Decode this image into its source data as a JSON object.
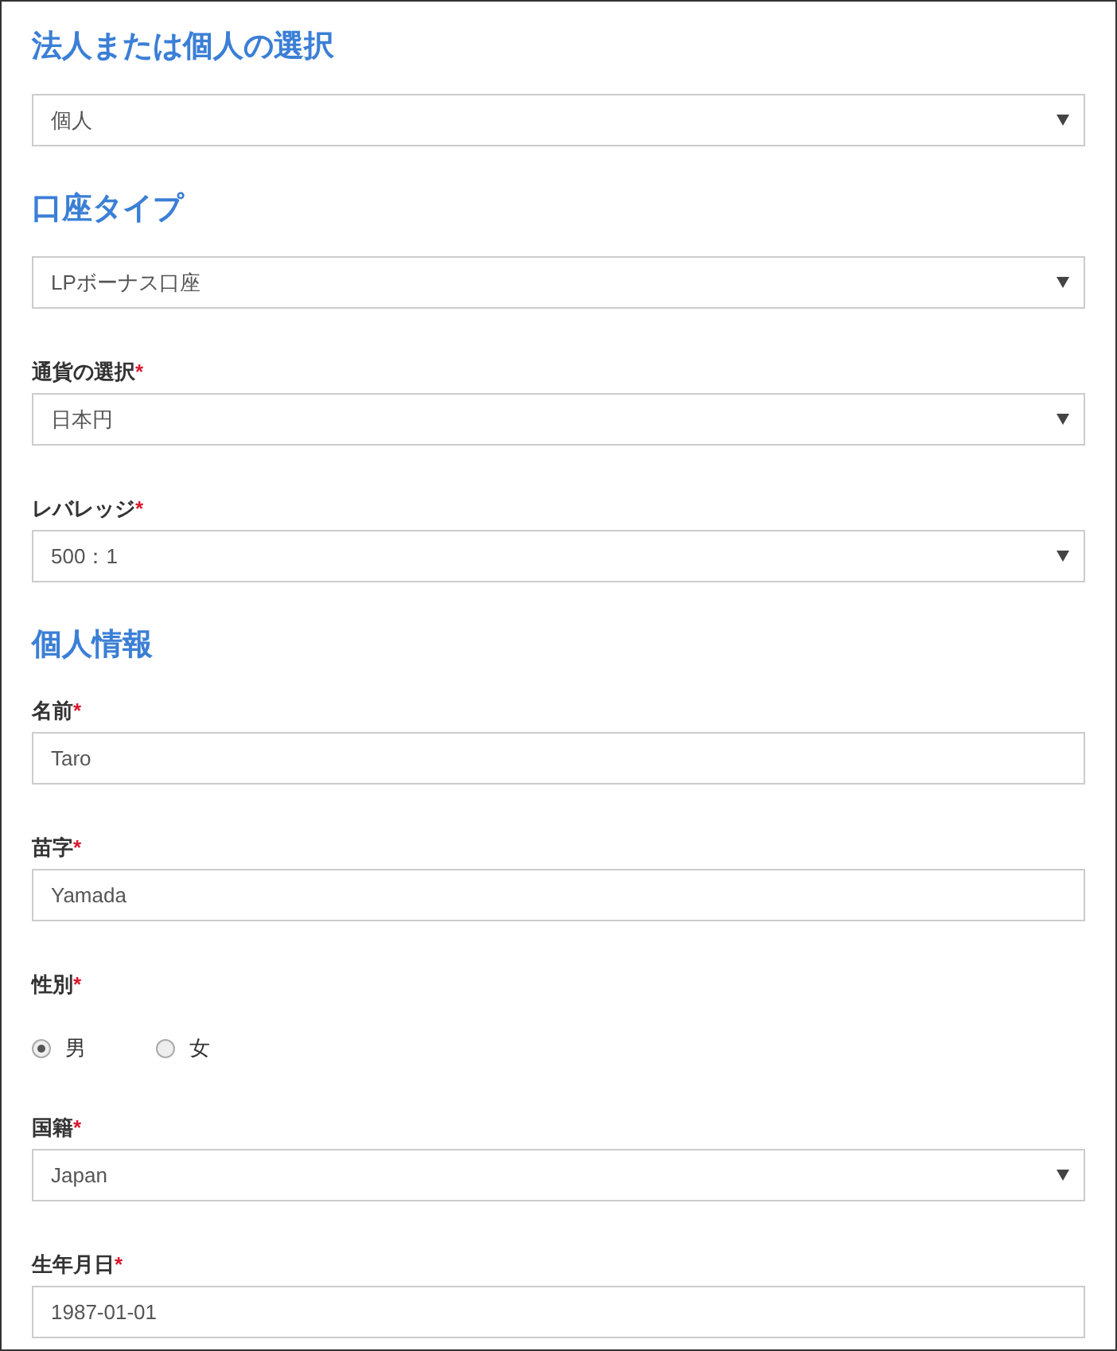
{
  "form": [
    {
      "kind": "heading",
      "text": "法人または個人の選択"
    },
    {
      "kind": "select",
      "value": "個人"
    },
    {
      "kind": "heading",
      "text": "口座タイプ"
    },
    {
      "kind": "select",
      "value": "LPボーナス口座"
    },
    {
      "kind": "label",
      "text": "通貨の選択",
      "mark": "*"
    },
    {
      "kind": "select",
      "value": "日本円"
    },
    {
      "kind": "label",
      "text": "レバレッジ",
      "mark": "*"
    },
    {
      "kind": "select",
      "value": "500：1"
    },
    {
      "kind": "heading",
      "text": "個人情報"
    },
    {
      "kind": "label",
      "text": "名前",
      "mark": "*"
    },
    {
      "kind": "input",
      "value": "Taro"
    },
    {
      "kind": "label",
      "text": "苗字",
      "mark": "*"
    },
    {
      "kind": "input",
      "value": "Yamada"
    },
    {
      "kind": "label",
      "text": "性別",
      "mark": "*"
    },
    {
      "kind": "radio",
      "options": [
        {
          "label": "男",
          "selected": true
        },
        {
          "label": "女",
          "selected": false
        }
      ]
    },
    {
      "kind": "label",
      "text": "国籍",
      "mark": "*"
    },
    {
      "kind": "select",
      "value": "Japan"
    },
    {
      "kind": "label",
      "text": "生年月日",
      "mark": "*"
    },
    {
      "kind": "input",
      "value": "1987-01-01"
    }
  ]
}
